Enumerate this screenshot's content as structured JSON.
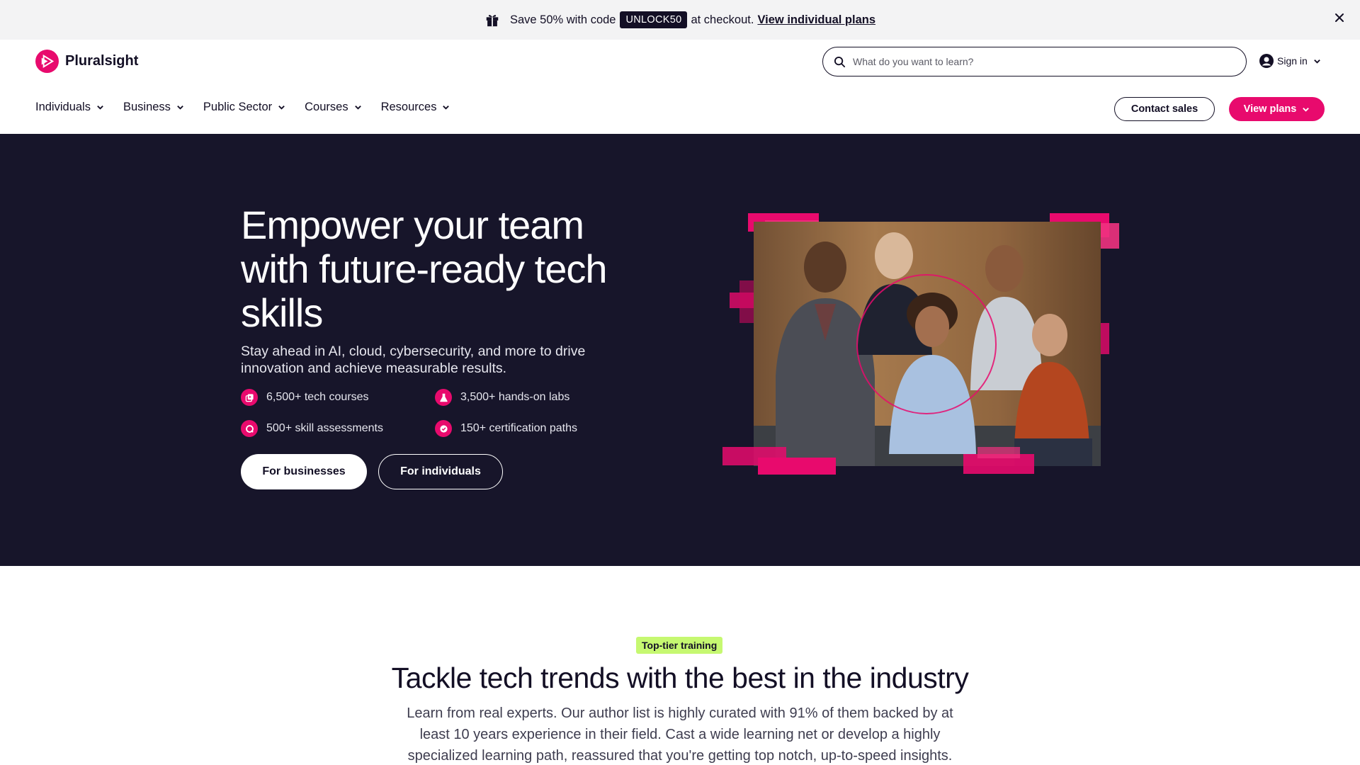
{
  "promo": {
    "text_before": "Save 50% with code",
    "code": "UNLOCK50",
    "text_after": "at checkout.",
    "link": "View individual plans"
  },
  "header": {
    "brand": "Pluralsight",
    "search_placeholder": "What do you want to learn?",
    "signin": "Sign in",
    "nav": [
      "Individuals",
      "Business",
      "Public Sector",
      "Courses",
      "Resources"
    ],
    "contact_sales": "Contact sales",
    "view_plans": "View plans"
  },
  "hero": {
    "title": "Empower your team with future-ready tech skills",
    "subtitle": "Stay ahead in AI, cloud, cybersecurity, and more to drive innovation and achieve measurable results.",
    "stats": [
      {
        "label": "6,500+ tech courses",
        "icon": "courses-icon"
      },
      {
        "label": "3,500+ hands-on labs",
        "icon": "lab-flask-icon"
      },
      {
        "label": "500+ skill assessments",
        "icon": "assessment-icon"
      },
      {
        "label": "150+ certification paths",
        "icon": "certification-check-icon"
      }
    ],
    "btn_business": "For businesses",
    "btn_individual": "For individuals"
  },
  "section": {
    "badge": "Top-tier training",
    "title": "Tackle tech trends with the best in the industry",
    "text": "Learn from real experts. Our author list is highly curated with 91% of them backed by at least 10 years experience in their field. Cast a wide learning net or develop a highly specialized learning path, reassured that you're getting top notch, up-to-speed insights."
  },
  "colors": {
    "brand_pink": "#e80a6d",
    "hero_bg": "#17152a",
    "badge_green": "#c6f871",
    "text_dark": "#130f25"
  }
}
